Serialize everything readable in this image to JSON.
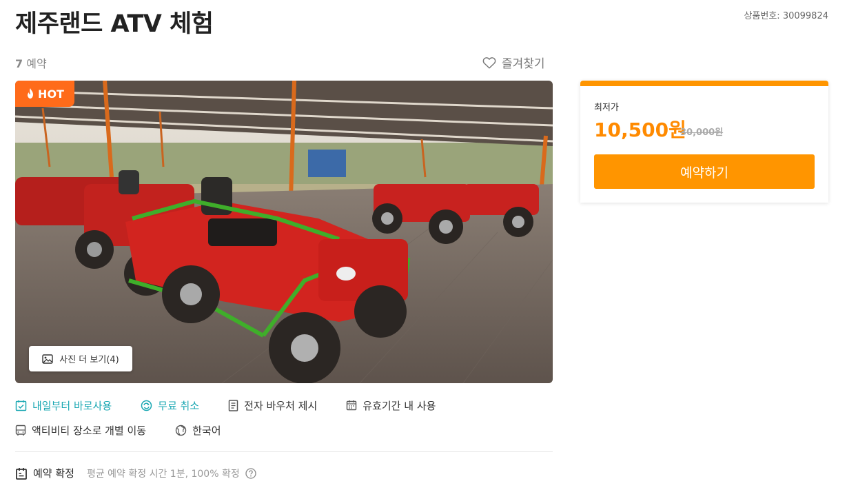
{
  "product": {
    "title": "제주랜드 ATV 체험",
    "product_number": "상품번호: 30099824",
    "booking_count": "7",
    "booking_label": "예약",
    "favorite_label": "즐겨찾기"
  },
  "gallery": {
    "hot_badge": "HOT",
    "more_photos": "사진 더 보기(4)"
  },
  "features": {
    "row1": [
      {
        "label": "내일부터 바로사용",
        "icon": "calendar-check-icon"
      },
      {
        "label": "무료 취소",
        "icon": "refresh-circle-icon"
      },
      {
        "label": "전자 바우처 제시",
        "icon": "document-icon"
      },
      {
        "label": "유효기간 내 사용",
        "icon": "calendar-icon"
      }
    ],
    "row2": [
      {
        "label": "액티비티 장소로 개별 이동",
        "icon": "bus-icon"
      },
      {
        "label": "한국어",
        "icon": "globe-icon"
      }
    ]
  },
  "confirmation": {
    "label": "예약 확정",
    "description": "평균 예약 확정 시간 1분, 100% 확정"
  },
  "pricing": {
    "label": "최저가",
    "current": "10,500원",
    "original": "30,000원",
    "book_button": "예약하기"
  },
  "colors": {
    "accent_orange": "#ff9500",
    "price_orange": "#ff8a00",
    "hot_badge": "#ff6b1a",
    "teal": "#1ba8b3"
  }
}
